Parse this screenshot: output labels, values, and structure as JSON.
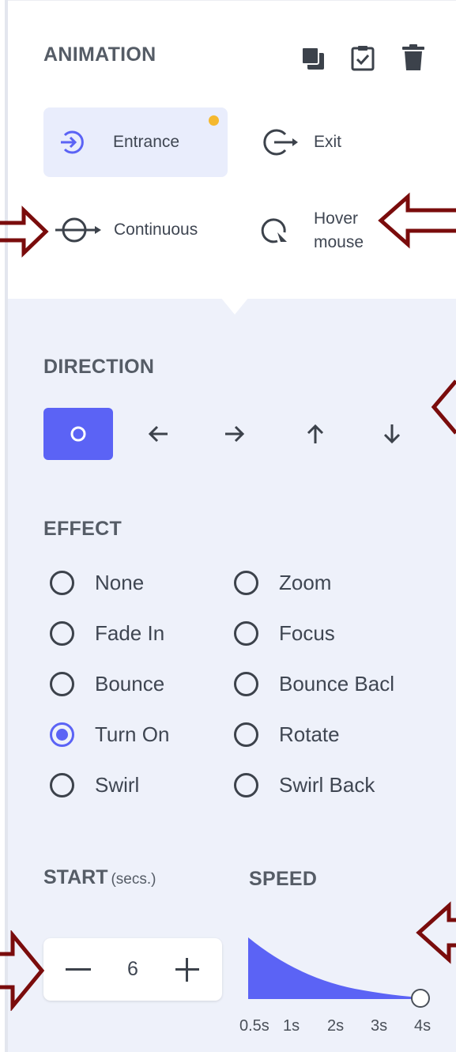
{
  "panel": {
    "title": "ANIMATION",
    "toolbar_icons": [
      "layers-icon",
      "clipboard-check-icon",
      "trash-icon"
    ]
  },
  "animation_types": [
    {
      "label": "Entrance",
      "icon": "entrance-icon",
      "selected": true,
      "has_indicator": true
    },
    {
      "label": "Exit",
      "icon": "exit-icon",
      "selected": false
    },
    {
      "label": "Continuous",
      "icon": "continuous-icon",
      "selected": false
    },
    {
      "label_line1": "Hover",
      "label_line2": "mouse",
      "icon": "hover-icon",
      "selected": false
    }
  ],
  "direction": {
    "title": "DIRECTION",
    "options": [
      "none-circle-icon",
      "arrow-left-icon",
      "arrow-right-icon",
      "arrow-up-icon",
      "arrow-down-icon"
    ],
    "selected": "none-circle-icon"
  },
  "effect": {
    "title": "EFFECT",
    "options": [
      "None",
      "Zoom",
      "Fade In",
      "Focus",
      "Bounce",
      "Bounce Bacl",
      "Turn On",
      "Rotate",
      "Swirl",
      "Swirl Back"
    ],
    "selected": "Turn On"
  },
  "start": {
    "title": "START",
    "unit": "(secs.)",
    "value": "6"
  },
  "speed": {
    "title": "SPEED",
    "ticks": [
      "0.5s",
      "1s",
      "2s",
      "3s",
      "4s"
    ],
    "selected": "4s"
  },
  "colors": {
    "accent": "#5b63f5",
    "indicator": "#f5b82e",
    "annotation_arrow": "#7a0c0c"
  }
}
